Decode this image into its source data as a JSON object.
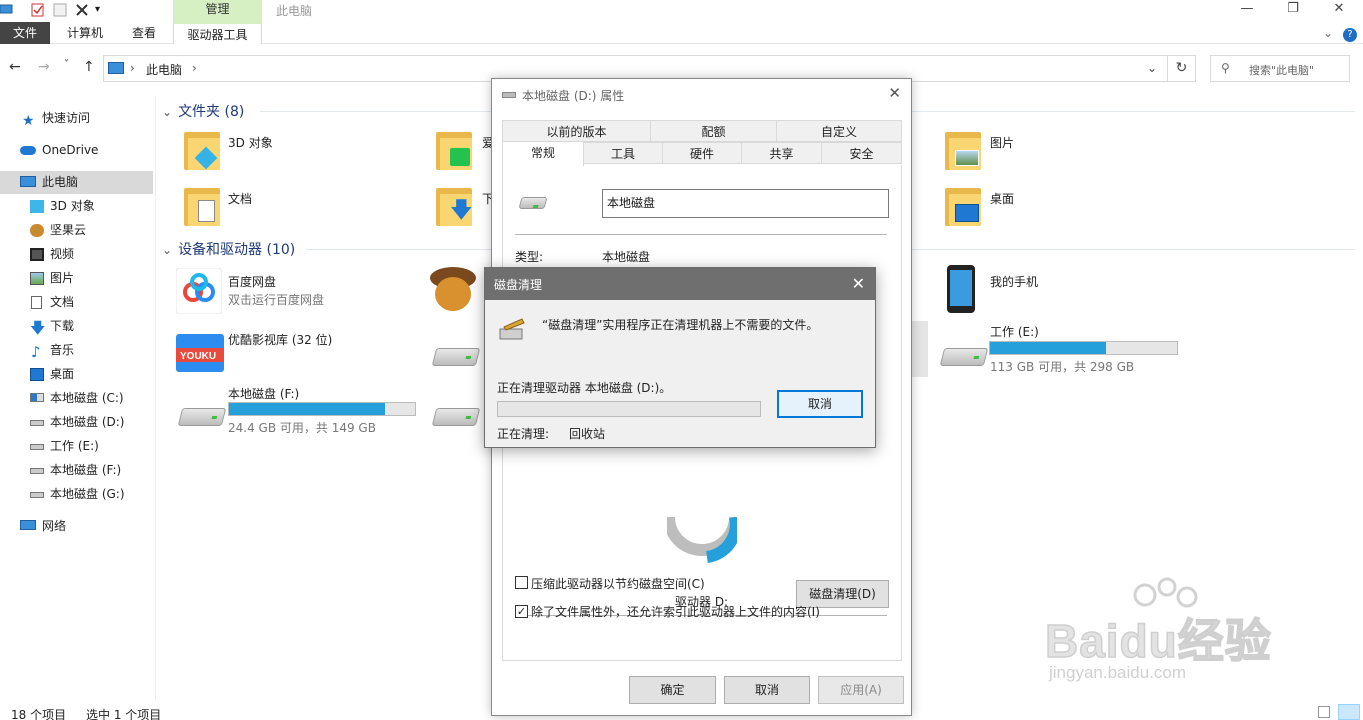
{
  "window": {
    "title": "此电脑",
    "context_tab_header": "管理",
    "controls": {
      "minimize": "—",
      "maximize": "❐",
      "close": "✕"
    }
  },
  "ribbon": {
    "tabs": [
      "文件",
      "计算机",
      "查看",
      "驱动器工具"
    ],
    "help": "?"
  },
  "navigation": {
    "back": "←",
    "forward": "→",
    "recent": "˅",
    "up": "↑",
    "breadcrumb": "此电脑",
    "refresh": "↻",
    "search_placeholder": "搜索\"此电脑\""
  },
  "sidebar": {
    "items": [
      {
        "label": "快速访问",
        "icon": "star-icon"
      },
      {
        "label": "OneDrive",
        "icon": "cloud-icon"
      },
      {
        "label": "此电脑",
        "icon": "computer-icon",
        "selected": true
      },
      {
        "label": "3D 对象",
        "icon": "cube-icon"
      },
      {
        "label": "坚果云",
        "icon": "nut-icon"
      },
      {
        "label": "视频",
        "icon": "video-icon"
      },
      {
        "label": "图片",
        "icon": "picture-icon"
      },
      {
        "label": "文档",
        "icon": "document-icon"
      },
      {
        "label": "下载",
        "icon": "download-icon"
      },
      {
        "label": "音乐",
        "icon": "music-icon"
      },
      {
        "label": "桌面",
        "icon": "desktop-icon"
      },
      {
        "label": "本地磁盘 (C:)",
        "icon": "drive-icon"
      },
      {
        "label": "本地磁盘 (D:)",
        "icon": "drive-icon"
      },
      {
        "label": "工作 (E:)",
        "icon": "drive-icon"
      },
      {
        "label": "本地磁盘 (F:)",
        "icon": "drive-icon"
      },
      {
        "label": "本地磁盘 (G:)",
        "icon": "drive-icon"
      },
      {
        "label": "网络",
        "icon": "network-icon"
      }
    ]
  },
  "main": {
    "folders_header": "文件夹 (8)",
    "folders": [
      {
        "label": "3D 对象"
      },
      {
        "label": "爱"
      },
      {
        "label": "图片"
      },
      {
        "label": "文档"
      },
      {
        "label": "下"
      },
      {
        "label": "桌面"
      }
    ],
    "devices_header": "设备和驱动器 (10)",
    "devices": {
      "baidu": {
        "label": "百度网盘",
        "sub": "双击运行百度网盘"
      },
      "youku": {
        "label": "优酷影视库 (32 位)"
      },
      "phone": {
        "label": "我的手机"
      },
      "drive_e": {
        "label": "工作 (E:)",
        "sub": "113 GB 可用，共 298 GB",
        "used_fraction": 0.62
      },
      "drive_f": {
        "label": "本地磁盘 (F:)",
        "sub": "24.4 GB 可用，共 149 GB",
        "used_fraction": 0.84
      }
    }
  },
  "properties_dialog": {
    "title": "本地磁盘 (D:) 属性",
    "tabs_row1": [
      "以前的版本",
      "配额",
      "自定义"
    ],
    "tabs_row2": [
      "常规",
      "工具",
      "硬件",
      "共享",
      "安全"
    ],
    "name_value": "本地磁盘",
    "type_label": "类型:",
    "type_value": "本地磁盘",
    "drive_label": "驱动器 D:",
    "disk_cleanup_button": "磁盘清理(D)",
    "compress_checkbox": {
      "label": "压缩此驱动器以节约磁盘空间(C)",
      "checked": false
    },
    "index_checkbox": {
      "label": "除了文件属性外，还允许索引此驱动器上文件的内容(I)",
      "checked": true
    },
    "ok": "确定",
    "cancel": "取消",
    "apply": "应用(A)"
  },
  "cleanup_dialog": {
    "title": "磁盘清理",
    "message": "“磁盘清理”实用程序正在清理机器上不需要的文件。",
    "cleaning_drive": "正在清理驱动器 本地磁盘 (D:)。",
    "cancel": "取消",
    "current_label": "正在清理:",
    "current_item": "回收站",
    "progress": 0
  },
  "statusbar": {
    "item_count": "18 个项目",
    "selected": "选中 1 个项目"
  },
  "watermark": {
    "brand": "Baidu经验",
    "url": "jingyan.baidu.com"
  }
}
